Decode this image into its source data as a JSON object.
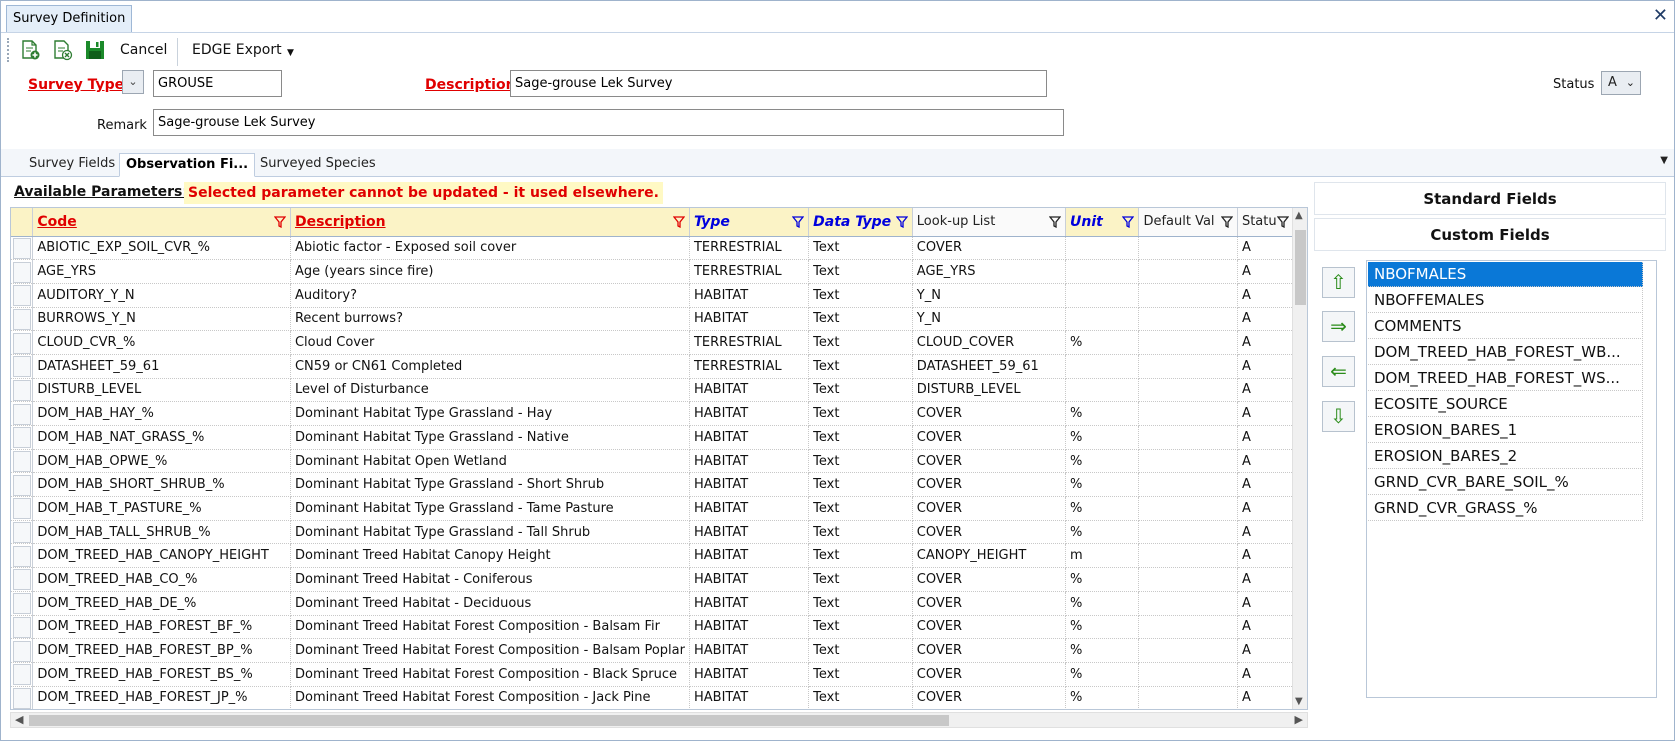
{
  "window": {
    "tab_title": "Survey Definition",
    "close_glyph": "✕"
  },
  "toolbar": {
    "new_icon": "new-document-icon",
    "delete_icon": "delete-document-icon",
    "save_icon": "save-disk-icon",
    "cancel_label": "Cancel",
    "export_label": "EDGE Export",
    "export_drop": "▼"
  },
  "header": {
    "survey_type_label": "Survey Type",
    "survey_type_value": "GROUSE",
    "description_label": "Description",
    "description_value": "Sage-grouse Lek Survey",
    "status_label": "Status",
    "status_value": "A",
    "remark_label": "Remark",
    "remark_value": "Sage-grouse Lek Survey"
  },
  "tabs": [
    {
      "label": "Survey Fields"
    },
    {
      "label": "Observation Fi..."
    },
    {
      "label": "Surveyed Species"
    }
  ],
  "available": {
    "label": "Available Parameters:",
    "warning": "Selected parameter cannot be updated - it used elsewhere."
  },
  "grid": {
    "columns": [
      "Code",
      "Description",
      "Type",
      "Data Type",
      "Look-up List",
      "Unit",
      "Default Val",
      "Statu"
    ],
    "rows": [
      [
        "ABIOTIC_EXP_SOIL_CVR_%",
        "Abiotic factor - Exposed soil cover",
        "TERRESTRIAL",
        "Text",
        "COVER",
        "",
        "",
        "A"
      ],
      [
        "AGE_YRS",
        "Age (years since fire)",
        "TERRESTRIAL",
        "Text",
        "AGE_YRS",
        "",
        "",
        "A"
      ],
      [
        "AUDITORY_Y_N",
        "Auditory?",
        "HABITAT",
        "Text",
        "Y_N",
        "",
        "",
        "A"
      ],
      [
        "BURROWS_Y_N",
        "Recent burrows?",
        "HABITAT",
        "Text",
        "Y_N",
        "",
        "",
        "A"
      ],
      [
        "CLOUD_CVR_%",
        "Cloud Cover",
        "TERRESTRIAL",
        "Text",
        "CLOUD_COVER",
        "%",
        "",
        "A"
      ],
      [
        "DATASHEET_59_61",
        "CN59 or CN61 Completed",
        "TERRESTRIAL",
        "Text",
        "DATASHEET_59_61",
        "",
        "",
        "A"
      ],
      [
        "DISTURB_LEVEL",
        "Level of Disturbance",
        "HABITAT",
        "Text",
        "DISTURB_LEVEL",
        "",
        "",
        "A"
      ],
      [
        "DOM_HAB_HAY_%",
        "Dominant Habitat Type Grassland - Hay",
        "HABITAT",
        "Text",
        "COVER",
        "%",
        "",
        "A"
      ],
      [
        "DOM_HAB_NAT_GRASS_%",
        "Dominant Habitat Type Grassland - Native",
        "HABITAT",
        "Text",
        "COVER",
        "%",
        "",
        "A"
      ],
      [
        "DOM_HAB_OPWE_%",
        "Dominant Habitat Open Wetland",
        "HABITAT",
        "Text",
        "COVER",
        "%",
        "",
        "A"
      ],
      [
        "DOM_HAB_SHORT_SHRUB_%",
        "Dominant Habitat Type Grassland - Short Shrub",
        "HABITAT",
        "Text",
        "COVER",
        "%",
        "",
        "A"
      ],
      [
        "DOM_HAB_T_PASTURE_%",
        "Dominant Habitat Type Grassland - Tame Pasture",
        "HABITAT",
        "Text",
        "COVER",
        "%",
        "",
        "A"
      ],
      [
        "DOM_HAB_TALL_SHRUB_%",
        "Dominant Habitat Type Grassland - Tall Shrub",
        "HABITAT",
        "Text",
        "COVER",
        "%",
        "",
        "A"
      ],
      [
        "DOM_TREED_HAB_CANOPY_HEIGHT",
        "Dominant Treed Habitat Canopy Height",
        "HABITAT",
        "Text",
        "CANOPY_HEIGHT",
        "m",
        "",
        "A"
      ],
      [
        "DOM_TREED_HAB_CO_%",
        "Dominant Treed Habitat - Coniferous",
        "HABITAT",
        "Text",
        "COVER",
        "%",
        "",
        "A"
      ],
      [
        "DOM_TREED_HAB_DE_%",
        "Dominant Treed Habitat - Deciduous",
        "HABITAT",
        "Text",
        "COVER",
        "%",
        "",
        "A"
      ],
      [
        "DOM_TREED_HAB_FOREST_BF_%",
        "Dominant Treed Habitat Forest Composition - Balsam Fir",
        "HABITAT",
        "Text",
        "COVER",
        "%",
        "",
        "A"
      ],
      [
        "DOM_TREED_HAB_FOREST_BP_%",
        "Dominant Treed Habitat Forest Composition - Balsam Poplar",
        "HABITAT",
        "Text",
        "COVER",
        "%",
        "",
        "A"
      ],
      [
        "DOM_TREED_HAB_FOREST_BS_%",
        "Dominant Treed Habitat Forest Composition - Black Spruce",
        "HABITAT",
        "Text",
        "COVER",
        "%",
        "",
        "A"
      ],
      [
        "DOM_TREED_HAB_FOREST_JP_%",
        "Dominant Treed Habitat Forest Composition - Jack Pine",
        "HABITAT",
        "Text",
        "COVER",
        "%",
        "",
        "A"
      ]
    ]
  },
  "right_panel": {
    "standard_label": "Standard Fields",
    "custom_label": "Custom Fields",
    "arrows": [
      "⇧",
      "⇒",
      "⇐",
      "⇩"
    ],
    "selected_fields": [
      "NBOFMALES",
      "NBOFFEMALES",
      "COMMENTS",
      "DOM_TREED_HAB_FOREST_WB...",
      "DOM_TREED_HAB_FOREST_WS...",
      "ECOSITE_SOURCE",
      "EROSION_BARES_1",
      "EROSION_BARES_2",
      "GRND_CVR_BARE_SOIL_%",
      "GRND_CVR_GRASS_%"
    ]
  },
  "colors": {
    "required_red": "#e00000",
    "keyfield_blue": "#0000dd",
    "header_yellow": "#fbf3c6",
    "selection_blue": "#0a78d7",
    "arrow_green": "#2b8c1a"
  }
}
